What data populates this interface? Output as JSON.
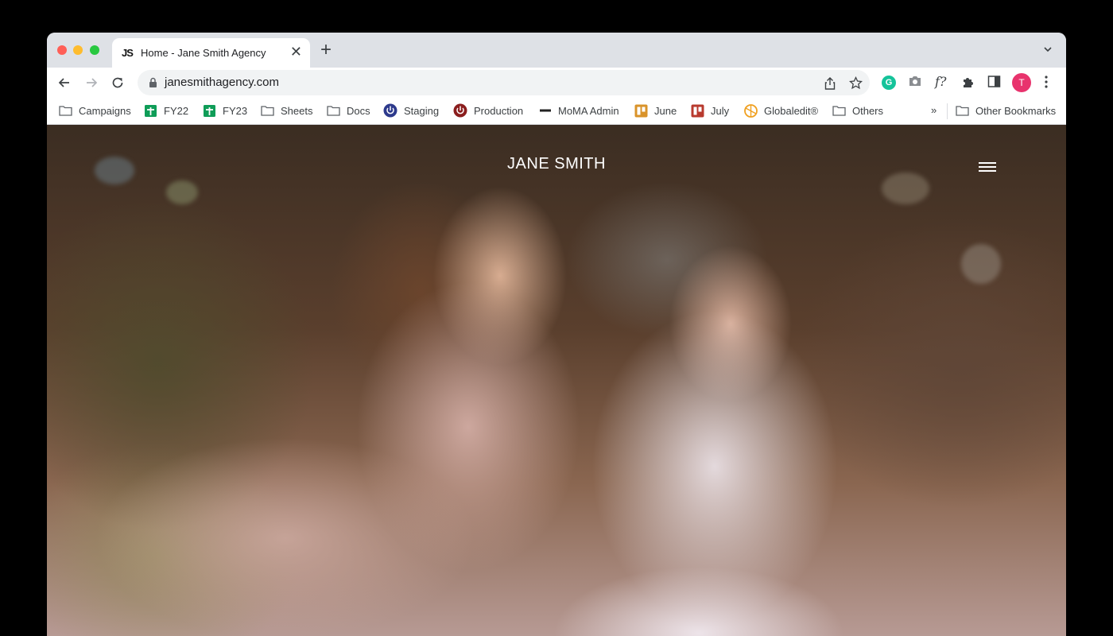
{
  "browser": {
    "tab": {
      "favicon_text": "JS",
      "title": "Home - Jane Smith Agency",
      "close_glyph": "✕"
    },
    "new_tab_glyph": "+",
    "url": "janesmithagency.com",
    "extensions": {
      "grammarly_letter": "G",
      "formula_label": "f?",
      "profile_initial": "T"
    },
    "bookmarks": [
      {
        "label": "Campaigns",
        "icon": "folder-icon"
      },
      {
        "label": "FY22",
        "icon": "sheets-icon"
      },
      {
        "label": "FY23",
        "icon": "sheets-icon"
      },
      {
        "label": "Sheets",
        "icon": "folder-icon"
      },
      {
        "label": "Docs",
        "icon": "folder-icon"
      },
      {
        "label": "Staging",
        "icon": "power-icon"
      },
      {
        "label": "Production",
        "icon": "power-icon"
      },
      {
        "label": "MoMA Admin",
        "icon": "moma-icon"
      },
      {
        "label": "June",
        "icon": "trello-icon"
      },
      {
        "label": "July",
        "icon": "trello-icon"
      },
      {
        "label": "Globaledit®",
        "icon": "globaledit-icon"
      },
      {
        "label": "Others",
        "icon": "folder-icon"
      }
    ],
    "overflow_glyph": "»",
    "other_bookmarks": "Other Bookmarks"
  },
  "site": {
    "logo": "JANE SMITH",
    "menu_icon": "hamburger-menu-icon"
  },
  "colors": {
    "traffic_close": "#ff5f57",
    "traffic_min": "#febc2e",
    "traffic_max": "#28c840",
    "profile_avatar": "#e8336d",
    "grammarly": "#15c39a"
  }
}
